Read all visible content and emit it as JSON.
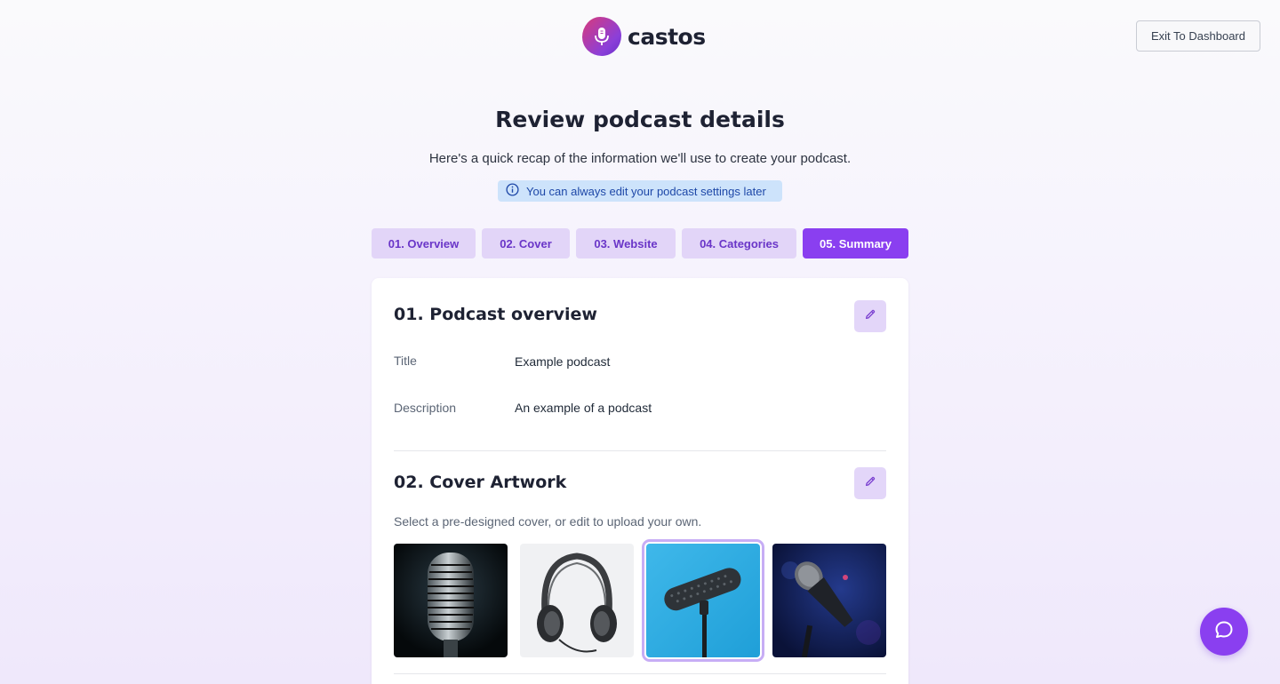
{
  "header": {
    "brand_name": "castos",
    "logo_icon": "microphone-icon",
    "exit_label": "Exit To Dashboard"
  },
  "page": {
    "title": "Review podcast details",
    "subtitle": "Here's a quick recap of the information we'll use to create your podcast.",
    "info_text": "You can always edit your podcast settings later",
    "info_icon": "info-icon"
  },
  "steps": [
    {
      "label": "01. Overview",
      "active": false
    },
    {
      "label": "02. Cover",
      "active": false
    },
    {
      "label": "03. Website",
      "active": false
    },
    {
      "label": "04. Categories",
      "active": false
    },
    {
      "label": "05. Summary",
      "active": true
    }
  ],
  "overview": {
    "heading": "01. Podcast overview",
    "rows": [
      {
        "label": "Title",
        "value": "Example podcast"
      },
      {
        "label": "Description",
        "value": "An example of a podcast"
      }
    ]
  },
  "cover": {
    "heading": "02. Cover Artwork",
    "hint": "Select a pre-designed cover, or edit to upload your own.",
    "options": [
      {
        "name": "vintage-microphone",
        "selected": false
      },
      {
        "name": "headphones",
        "selected": false
      },
      {
        "name": "boom-microphone",
        "selected": true
      },
      {
        "name": "stage-microphone",
        "selected": false
      }
    ]
  },
  "colors": {
    "accent": "#8a3ff0",
    "accent_light": "#e2d5f8",
    "info_bg": "#cde3fb",
    "info_text": "#1e48a8"
  },
  "chat": {
    "icon": "chat-bubble-icon"
  }
}
